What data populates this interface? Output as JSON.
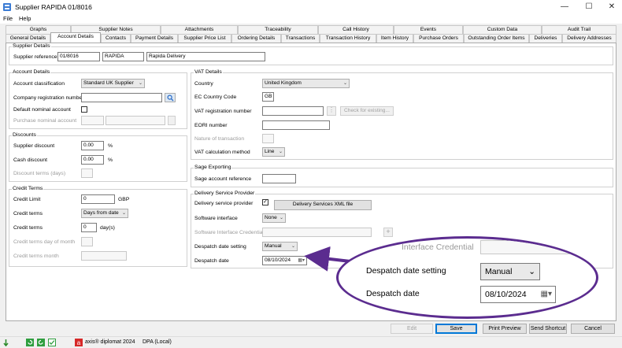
{
  "window": {
    "title": "Supplier RAPIDA 01/8016",
    "minimize_glyph": "—",
    "maximize_glyph": "☐",
    "close_glyph": "✕"
  },
  "menu": [
    "File",
    "Help"
  ],
  "tabs_row1": [
    "Graphs",
    "Supplier Notes",
    "Attachments",
    "Traceability",
    "Call History",
    "Events",
    "Custom Data",
    "Audit Trail"
  ],
  "tabs_row2": [
    "General Details",
    "Account Details",
    "Contacts",
    "Payment Details",
    "Supplier Price List",
    "Ordering Details",
    "Transactions",
    "Transaction History",
    "Item History",
    "Purchase Orders",
    "Outstanding Order Items",
    "Deliveries",
    "Delivery Addresses"
  ],
  "supplier_details": {
    "title": "Supplier Details",
    "ref_label": "Supplier reference",
    "ref_value": "01/8016",
    "short_name": "RAPIDA",
    "full_name": "Rapida Delivery"
  },
  "account_details": {
    "title": "Account Details",
    "classification_label": "Account classification",
    "classification_value": "Standard UK Supplier",
    "company_reg_label": "Company registration number",
    "company_reg_value": "",
    "default_nominal_label": "Default nominal account",
    "purchase_nominal_label": "Purchase nominal account"
  },
  "discounts": {
    "title": "Discounts",
    "supplier_label": "Supplier discount",
    "supplier_value": "0.00",
    "pct": "%",
    "cash_label": "Cash discount",
    "cash_value": "0.00",
    "terms_label": "Discount terms (days)"
  },
  "credit_terms": {
    "title": "Credit Terms",
    "limit_label": "Credit Limit",
    "limit_value": "0",
    "currency": "GBP",
    "terms_label": "Credit terms",
    "terms_value": "Days from date",
    "terms2_label": "Credit terms",
    "terms2_value": "0",
    "days_unit": "day(s)",
    "dom_label": "Credit terms day of month",
    "month_label": "Credit terms month"
  },
  "vat_details": {
    "title": "VAT Details",
    "country_label": "Country",
    "country_value": "United Kingdom",
    "ec_label": "EC Country Code",
    "ec_value": "GB",
    "vat_reg_label": "VAT registration number",
    "check_button": "Check for existing...",
    "eori_label": "EORI number",
    "nature_label": "Nature of transaction",
    "calc_label": "VAT calculation method",
    "calc_value": "Line"
  },
  "sage": {
    "title": "Sage Exporting",
    "ref_label": "Sage account reference"
  },
  "delivery": {
    "title": "Delivery Service Provider",
    "provider_label": "Delivery service provider",
    "xml_button": "Delivery Services XML file",
    "interface_label": "Software interface",
    "interface_value": "None",
    "credential_label": "Software Interface Credential",
    "despatch_setting_label": "Despatch date setting",
    "despatch_setting_value": "Manual",
    "despatch_date_label": "Despatch date",
    "despatch_date_value": "08/10/2024"
  },
  "zoom": {
    "partial_label": "Interface Credential",
    "setting_label": "Despatch date setting",
    "setting_value": "Manual",
    "date_label": "Despatch date",
    "date_value": "08/10/2024"
  },
  "buttons": {
    "edit": "Edit",
    "save": "Save",
    "print_preview": "Print Preview",
    "send_shortcut": "Send Shortcut",
    "cancel": "Cancel"
  },
  "status": {
    "product": "axis® diplomat 2024",
    "db": "DPA (Local)"
  },
  "colors": {
    "accent": "#5b2c8f",
    "save_border": "#0078d7"
  }
}
